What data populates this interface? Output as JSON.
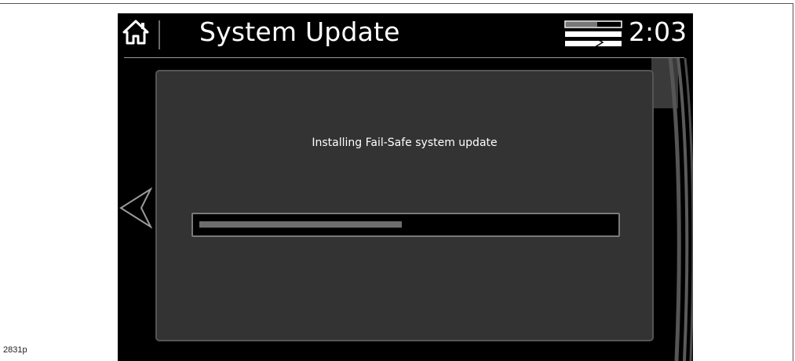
{
  "figure_id": "2831p",
  "header": {
    "title": "System Update",
    "clock": "2:03",
    "home_icon": "home-icon",
    "status_icon": "signal-status-icon"
  },
  "navigation": {
    "back_icon": "chevron-left-icon"
  },
  "main": {
    "message": "Installing Fail-Safe system update",
    "progress_fraction": 0.49
  },
  "colors": {
    "screen_background": "#000000",
    "panel_background": "#333333",
    "panel_border": "#555555",
    "progress_fill": "#6d6d6d",
    "text": "#ffffff"
  }
}
